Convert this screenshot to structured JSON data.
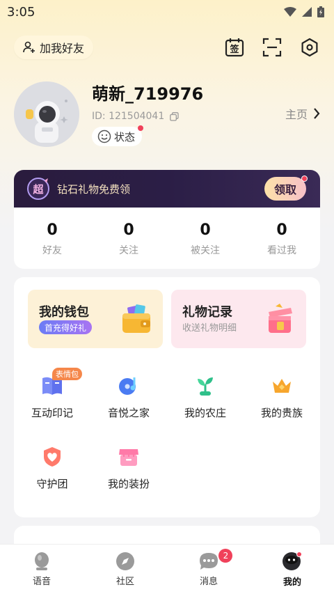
{
  "status_bar": {
    "time": "3:05"
  },
  "topbar": {
    "add_friend_label": "加我好友",
    "icons": [
      "sign-in-calendar-icon",
      "scan-icon",
      "settings-icon"
    ],
    "sign_glyph": "签"
  },
  "profile": {
    "username": "萌新_719976",
    "id_text": "ID: 121504041",
    "status_label": "状态",
    "homepage_label": "主页"
  },
  "vip": {
    "badge_glyph": "超",
    "text": "钻石礼物免费领",
    "claim_label": "领取"
  },
  "stats": [
    {
      "value": "0",
      "label": "好友"
    },
    {
      "value": "0",
      "label": "关注"
    },
    {
      "value": "0",
      "label": "被关注"
    },
    {
      "value": "0",
      "label": "看过我"
    }
  ],
  "wallet": {
    "title": "我的钱包",
    "pill": "首充得好礼"
  },
  "gift_record": {
    "title": "礼物记录",
    "subtitle": "收送礼物明细"
  },
  "grid": [
    {
      "label": "互动印记",
      "tag": "表情包",
      "icon": "book-icon"
    },
    {
      "label": "音悦之家",
      "icon": "music-disc-icon"
    },
    {
      "label": "我的农庄",
      "icon": "sprout-icon"
    },
    {
      "label": "我的贵族",
      "icon": "crown-icon"
    },
    {
      "label": "守护团",
      "icon": "heart-shield-icon"
    },
    {
      "label": "我的装扮",
      "icon": "shop-icon"
    }
  ],
  "nav": [
    {
      "label": "语音",
      "icon": "mic-icon"
    },
    {
      "label": "社区",
      "icon": "compass-icon"
    },
    {
      "label": "消息",
      "icon": "message-icon",
      "badge": "2"
    },
    {
      "label": "我的",
      "icon": "profile-icon",
      "active": true
    }
  ],
  "colors": {
    "accent": "#f0415a",
    "nav_active": "#111111",
    "wallet_bg": "#fdf1d7",
    "gift_bg": "#fde8ee"
  }
}
